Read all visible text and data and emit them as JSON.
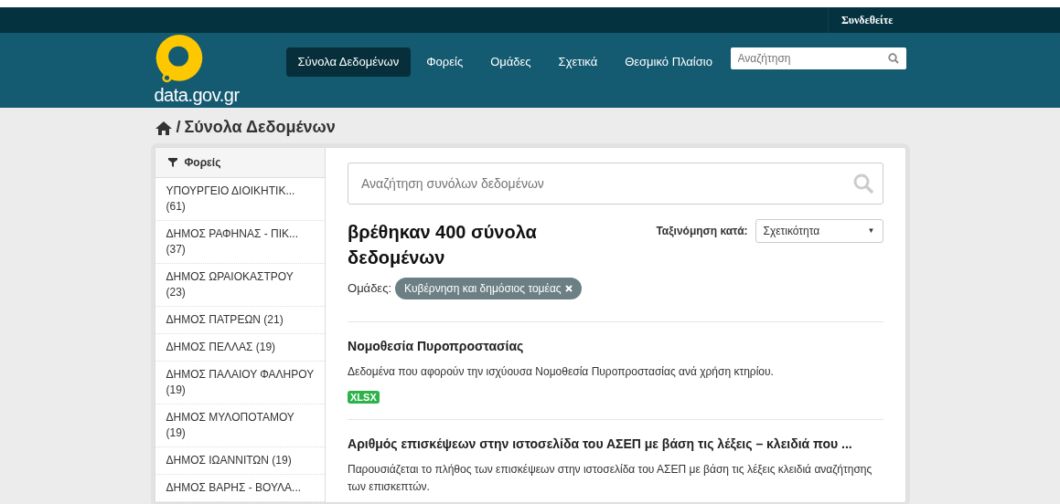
{
  "topbar": {
    "login": "Συνδεθείτε"
  },
  "header": {
    "logo_text": "data.gov.gr",
    "nav": [
      {
        "label": "Σύνολα Δεδομένων",
        "selected": true
      },
      {
        "label": "Φορείς",
        "selected": false
      },
      {
        "label": "Ομάδες",
        "selected": false
      },
      {
        "label": "Σχετικά",
        "selected": false
      },
      {
        "label": "Θεσμικό Πλαίσιο",
        "selected": false
      }
    ],
    "search": {
      "placeholder": "Αναζήτηση"
    }
  },
  "breadcrumb": {
    "separator": "/",
    "current": "Σύνολα Δεδομένων"
  },
  "sidebar": {
    "title": "Φορείς",
    "items": [
      {
        "label": "ΥΠΟΥΡΓΕΙΟ ΔΙΟΙΚΗΤΙΚ...",
        "count": "(61)"
      },
      {
        "label": "ΔΗΜΟΣ ΡΑΦΗΝΑΣ - ΠΙΚ...",
        "count": "(37)"
      },
      {
        "label": "ΔΗΜΟΣ ΩΡΑΙΟΚΑΣΤΡΟΥ",
        "count": "(23)"
      },
      {
        "label": "ΔΗΜΟΣ ΠΑΤΡΕΩΝ",
        "count": "(21)"
      },
      {
        "label": "ΔΗΜΟΣ ΠΕΛΛΑΣ",
        "count": "(19)"
      },
      {
        "label": "ΔΗΜΟΣ ΠΑΛΑΙΟΥ ΦΑΛΗΡΟΥ",
        "count": "(19)"
      },
      {
        "label": "ΔΗΜΟΣ ΜΥΛΟΠΟΤΑΜΟΥ",
        "count": "(19)"
      },
      {
        "label": "ΔΗΜΟΣ ΙΩΑΝΝΙΤΩΝ",
        "count": "(19)"
      },
      {
        "label": "ΔΗΜΟΣ ΒΑΡΗΣ - ΒΟΥΛΑ..."
      }
    ]
  },
  "main": {
    "search": {
      "placeholder": "Αναζήτηση συνόλων δεδομένων"
    },
    "result_heading": "βρέθηκαν 400 σύνολα δεδομένων",
    "sort": {
      "label": "Ταξινόμηση κατά:",
      "value": "Σχετικότητα",
      "caret": "▼"
    },
    "filter": {
      "label": "Ομάδες:",
      "tag": "Κυβέρνηση και δημόσιος τομέας"
    },
    "datasets": [
      {
        "title": "Νομοθεσία Πυροπροστασίας",
        "description": "Δεδομένα που αφορούν την ισχύουσα Νομοθεσία Πυροπροστασίας ανά χρήση κτηρίου.",
        "formats": [
          "XLSX"
        ]
      },
      {
        "title": "Αριθμός επισκέψεων στην ιστοσελίδα του ΑΣΕΠ με βάση τις λέξεις – κλειδιά που ...",
        "description": "Παρουσιάζεται το πλήθος των επισκέψεων στην ιστοσελίδα του ΑΣΕΠ με βάση τις λέξεις κλειδιά αναζήτησης των επισκεπτών."
      }
    ]
  }
}
